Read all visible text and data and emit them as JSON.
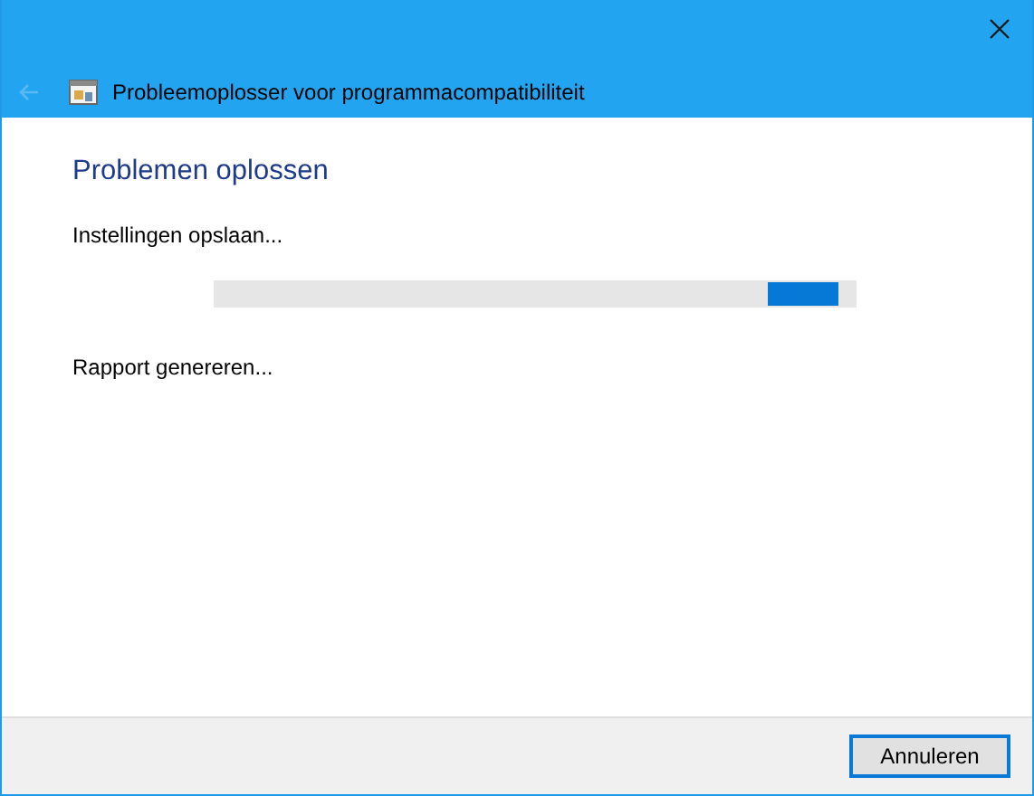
{
  "window": {
    "title": "Probleemoplosser voor programmacompatibiliteit",
    "back_disabled": true
  },
  "heading": "Problemen oplossen",
  "steps": [
    {
      "text": "Instellingen opslaan...",
      "kind": "progress",
      "indeterminate": true
    },
    {
      "text": "Rapport genereren...",
      "kind": "text"
    }
  ],
  "buttons": [
    {
      "label": "Annuleren",
      "default": true
    }
  ]
}
